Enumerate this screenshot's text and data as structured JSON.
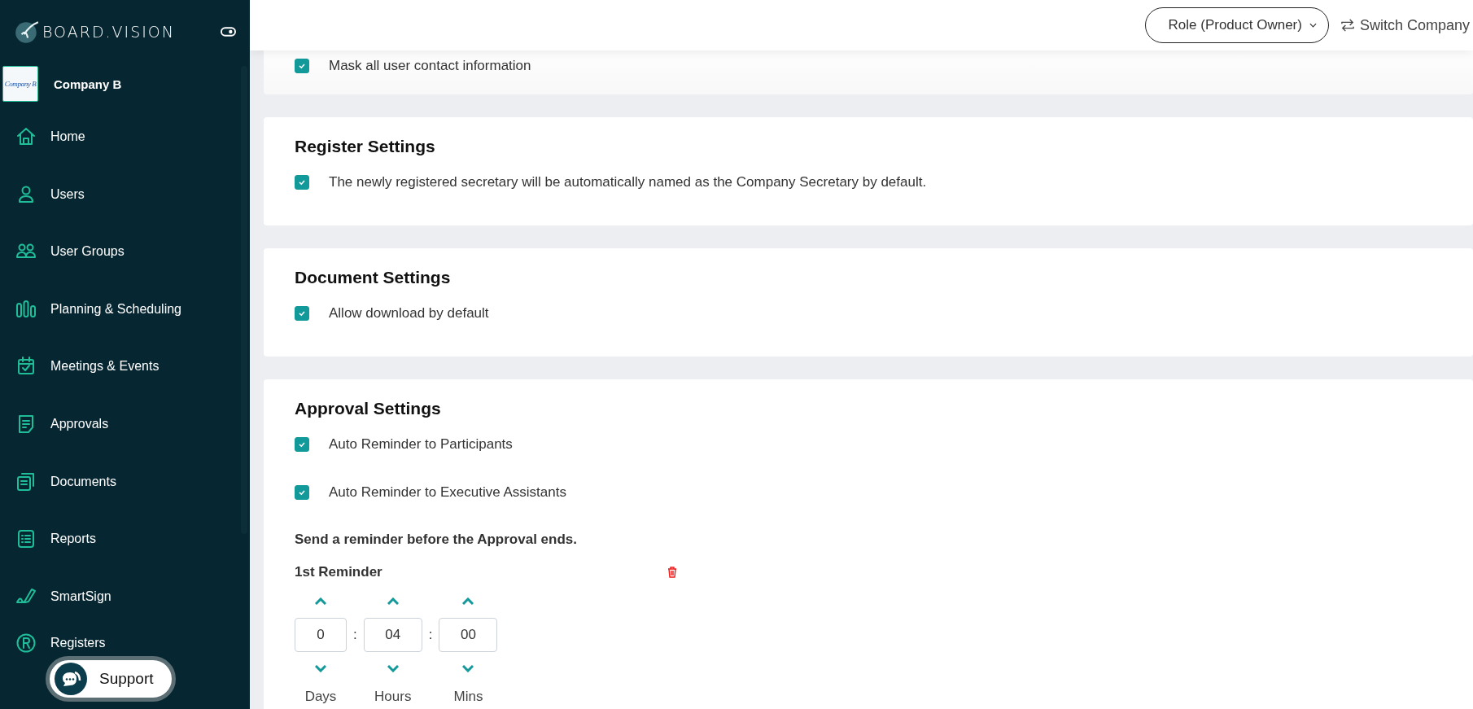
{
  "sidebar": {
    "brand": "BOARD.VISION",
    "company": {
      "logo_text": "Company B",
      "name": "Company B"
    },
    "items": [
      {
        "label": "Home"
      },
      {
        "label": "Users"
      },
      {
        "label": "User Groups"
      },
      {
        "label": "Planning & Scheduling"
      },
      {
        "label": "Meetings & Events"
      },
      {
        "label": "Approvals"
      },
      {
        "label": "Documents"
      },
      {
        "label": "Reports"
      },
      {
        "label": "SmartSign"
      },
      {
        "label": "Registers"
      }
    ],
    "support": "Support"
  },
  "header": {
    "role": "Role (Product Owner)",
    "switch": "Switch Company"
  },
  "sections": [
    {
      "options": [
        {
          "label": "Mask all user contact information",
          "checked": true
        }
      ]
    },
    {
      "title": "Register Settings",
      "options": [
        {
          "label": "The newly registered secretary will be automatically named as the Company Secretary by default.",
          "checked": true
        }
      ]
    },
    {
      "title": "Document Settings",
      "options": [
        {
          "label": "Allow download by default",
          "checked": true
        }
      ]
    },
    {
      "title": "Approval Settings",
      "options": [
        {
          "label": "Auto Reminder to Participants",
          "checked": true
        },
        {
          "label": "Auto Reminder to Executive Assistants",
          "checked": true
        }
      ],
      "reminder_note": "Send a reminder before the Approval ends.",
      "reminders": [
        {
          "title": "1st Reminder",
          "fields": [
            {
              "value": "0",
              "label": "Days"
            },
            {
              "separator": ":",
              "value": "04",
              "label": "Hours"
            },
            {
              "separator": ":",
              "value": "00",
              "label": "Mins"
            }
          ]
        }
      ]
    }
  ]
}
